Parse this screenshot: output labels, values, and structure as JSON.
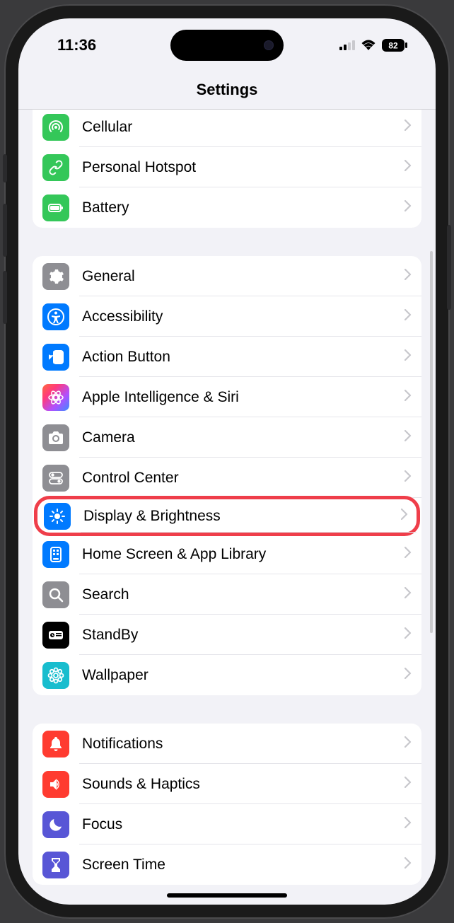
{
  "status": {
    "time": "11:36",
    "battery": "82"
  },
  "nav": {
    "title": "Settings"
  },
  "groups": [
    {
      "first": true,
      "items": [
        {
          "id": "cellular",
          "label": "Cellular",
          "icon": "antenna-icon",
          "bg": "#34c759"
        },
        {
          "id": "hotspot",
          "label": "Personal Hotspot",
          "icon": "link-icon",
          "bg": "#34c759"
        },
        {
          "id": "battery",
          "label": "Battery",
          "icon": "battery-icon",
          "bg": "#34c759"
        }
      ]
    },
    {
      "items": [
        {
          "id": "general",
          "label": "General",
          "icon": "gear-icon",
          "bg": "#8e8e93"
        },
        {
          "id": "accessibility",
          "label": "Accessibility",
          "icon": "accessibility-icon",
          "bg": "#007aff"
        },
        {
          "id": "action-button",
          "label": "Action Button",
          "icon": "action-button-icon",
          "bg": "#007aff"
        },
        {
          "id": "apple-intelligence",
          "label": "Apple Intelligence & Siri",
          "icon": "intelligence-icon",
          "bg": "gradient-ai"
        },
        {
          "id": "camera",
          "label": "Camera",
          "icon": "camera-icon",
          "bg": "#8e8e93"
        },
        {
          "id": "control-center",
          "label": "Control Center",
          "icon": "switches-icon",
          "bg": "#8e8e93"
        },
        {
          "id": "display",
          "label": "Display & Brightness",
          "icon": "brightness-icon",
          "bg": "#007aff",
          "highlight": true
        },
        {
          "id": "home-screen",
          "label": "Home Screen & App Library",
          "icon": "home-grid-icon",
          "bg": "#007aff"
        },
        {
          "id": "search",
          "label": "Search",
          "icon": "search-icon",
          "bg": "#8e8e93"
        },
        {
          "id": "standby",
          "label": "StandBy",
          "icon": "standby-icon",
          "bg": "#000000"
        },
        {
          "id": "wallpaper",
          "label": "Wallpaper",
          "icon": "wallpaper-icon",
          "bg": "#18bdce"
        }
      ]
    },
    {
      "items": [
        {
          "id": "notifications",
          "label": "Notifications",
          "icon": "bell-icon",
          "bg": "#ff3b30"
        },
        {
          "id": "sounds",
          "label": "Sounds & Haptics",
          "icon": "speaker-icon",
          "bg": "#ff3b30"
        },
        {
          "id": "focus",
          "label": "Focus",
          "icon": "moon-icon",
          "bg": "#5856d6"
        },
        {
          "id": "screen-time",
          "label": "Screen Time",
          "icon": "hourglass-icon",
          "bg": "#5856d6"
        }
      ]
    }
  ]
}
